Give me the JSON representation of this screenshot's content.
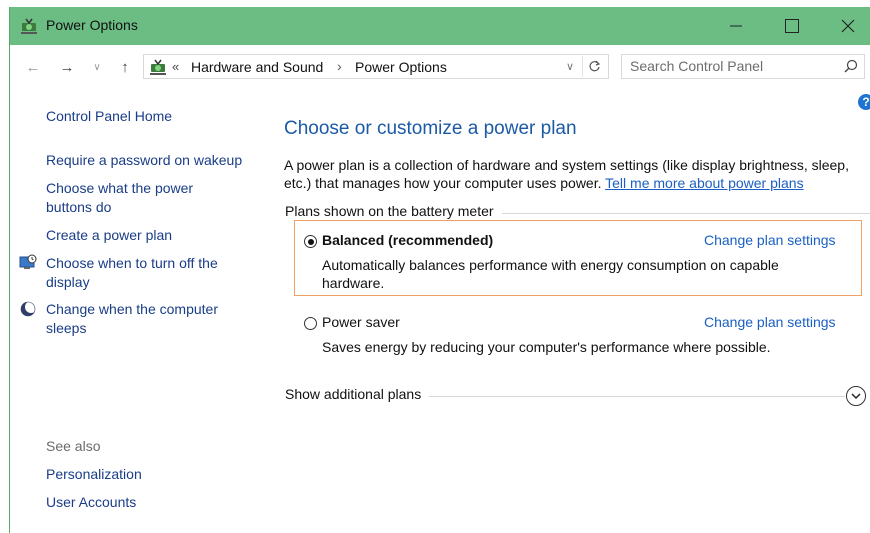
{
  "window": {
    "title": "Power Options"
  },
  "nav": {
    "breadcrumb_chevron": "«",
    "breadcrumbs": [
      "Hardware and Sound",
      "Power Options"
    ],
    "search_placeholder": "Search Control Panel"
  },
  "sidebar": {
    "home": "Control Panel Home",
    "links": [
      {
        "label": "Require a password on wakeup",
        "icon": ""
      },
      {
        "label": "Choose what the power buttons do",
        "icon": ""
      },
      {
        "label": "Create a power plan",
        "icon": ""
      },
      {
        "label": "Choose when to turn off the display",
        "icon": "monitor-clock-icon"
      },
      {
        "label": "Change when the computer sleeps",
        "icon": "moon-icon"
      }
    ],
    "see_also_heading": "See also",
    "see_also": [
      "Personalization",
      "User Accounts"
    ]
  },
  "main": {
    "title": "Choose or customize a power plan",
    "description": "A power plan is a collection of hardware and system settings (like display brightness, sleep, etc.) that manages how your computer uses power.",
    "description_link": "Tell me more about power plans",
    "section_label": "Plans shown on the battery meter",
    "plans": [
      {
        "name": "Balanced (recommended)",
        "selected": true,
        "link": "Change plan settings",
        "description": "Automatically balances performance with energy consumption on capable hardware."
      },
      {
        "name": "Power saver",
        "selected": false,
        "link": "Change plan settings",
        "description": "Saves energy by reducing your computer's performance where possible."
      }
    ],
    "additional_plans": "Show additional plans"
  },
  "colors": {
    "titlebar": "#6cbd84",
    "link": "#1a5fc4",
    "title": "#1c5aa6",
    "selected_border": "#f0a266",
    "sidebar_link": "#1a3d87"
  }
}
